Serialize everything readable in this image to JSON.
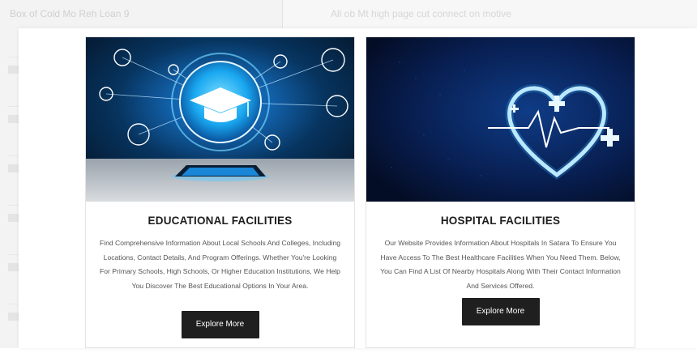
{
  "background": {
    "header_left": "Box of Cold Mo Reh Loan 9",
    "header_right": "All ob Mt high page cut connect on motive"
  },
  "cards": [
    {
      "title": "EDUCATIONAL FACILITIES",
      "description": "Find Comprehensive Information About Local Schools And Colleges, Including Locations, Contact Details, And Program Offerings. Whether You're Looking For Primary Schools, High Schools, Or Higher Education Institutions, We Help You Discover The Best Educational Options In Your Area.",
      "button_label": "Explore More",
      "image_icon": "graduation-cap-network"
    },
    {
      "title": "HOSPITAL FACILITIES",
      "description": "Our Website Provides Information About Hospitals In Satara To Ensure You Have Access To The Best Healthcare Facilities When You Need Them. Below, You Can Find A List Of Nearby Hospitals Along With Their Contact Information And Services Offered.",
      "button_label": "Explore More",
      "image_icon": "heart-pulse-cross"
    }
  ],
  "colors": {
    "button_bg": "#1f1f1f",
    "title_text": "#1d1d1d",
    "body_text": "#555555",
    "edu_image_blue": "#0a6bd6",
    "hosp_image_blue": "#06163d"
  }
}
